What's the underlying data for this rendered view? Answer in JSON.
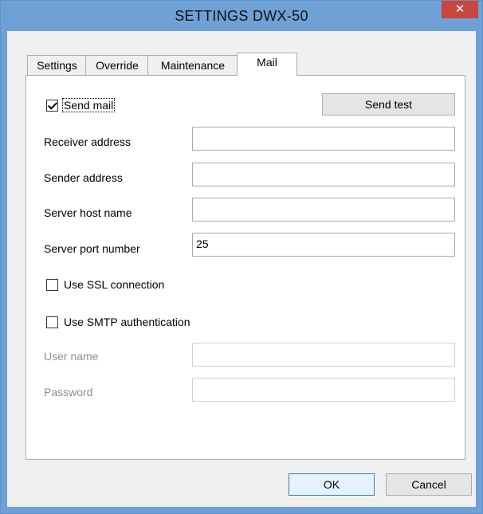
{
  "window": {
    "title": "SETTINGS DWX-50",
    "close_glyph": "✕"
  },
  "tabs": [
    {
      "label": "Settings",
      "active": false
    },
    {
      "label": "Override",
      "active": false
    },
    {
      "label": "Maintenance",
      "active": false
    },
    {
      "label": "Mail",
      "active": true
    }
  ],
  "mail": {
    "send_mail_label": "Send mail",
    "send_mail_checked": true,
    "send_test_label": "Send test",
    "receiver_address_label": "Receiver address",
    "receiver_address_value": "",
    "sender_address_label": "Sender address",
    "sender_address_value": "",
    "server_host_label": "Server host name",
    "server_host_value": "",
    "server_port_label": "Server port number",
    "server_port_value": "25",
    "use_ssl_label": "Use SSL connection",
    "use_ssl_checked": false,
    "use_smtp_auth_label": "Use SMTP authentication",
    "use_smtp_auth_checked": false,
    "user_name_label": "User name",
    "user_name_value": "",
    "password_label": "Password",
    "password_value": ""
  },
  "footer": {
    "ok_label": "OK",
    "cancel_label": "Cancel"
  },
  "colors": {
    "titlebar": "#6fa1d6",
    "close": "#c9463d",
    "dialog_bg": "#f0f0f0"
  }
}
